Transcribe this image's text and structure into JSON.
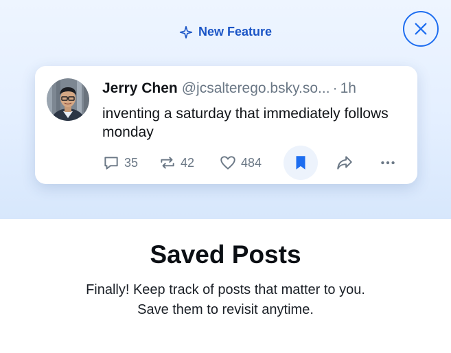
{
  "badge": {
    "icon": "sparkle-icon",
    "label": "New Feature"
  },
  "close": {
    "icon": "close-icon"
  },
  "post": {
    "author": "Jerry Chen",
    "handle": "@jcsalterego.bsky.so...",
    "separator": "·",
    "time": "1h",
    "text": "inventing a saturday that immediately follows monday",
    "reply_count": "35",
    "repost_count": "42",
    "like_count": "484"
  },
  "title": "Saved Posts",
  "description_line1": "Finally! Keep track of posts that matter to you.",
  "description_line2": "Save them to revisit anytime.",
  "colors": {
    "accent": "#1d6df0",
    "badge_text": "#1b55c6",
    "muted": "#6a7785",
    "hero_bg": "#e4efff"
  }
}
